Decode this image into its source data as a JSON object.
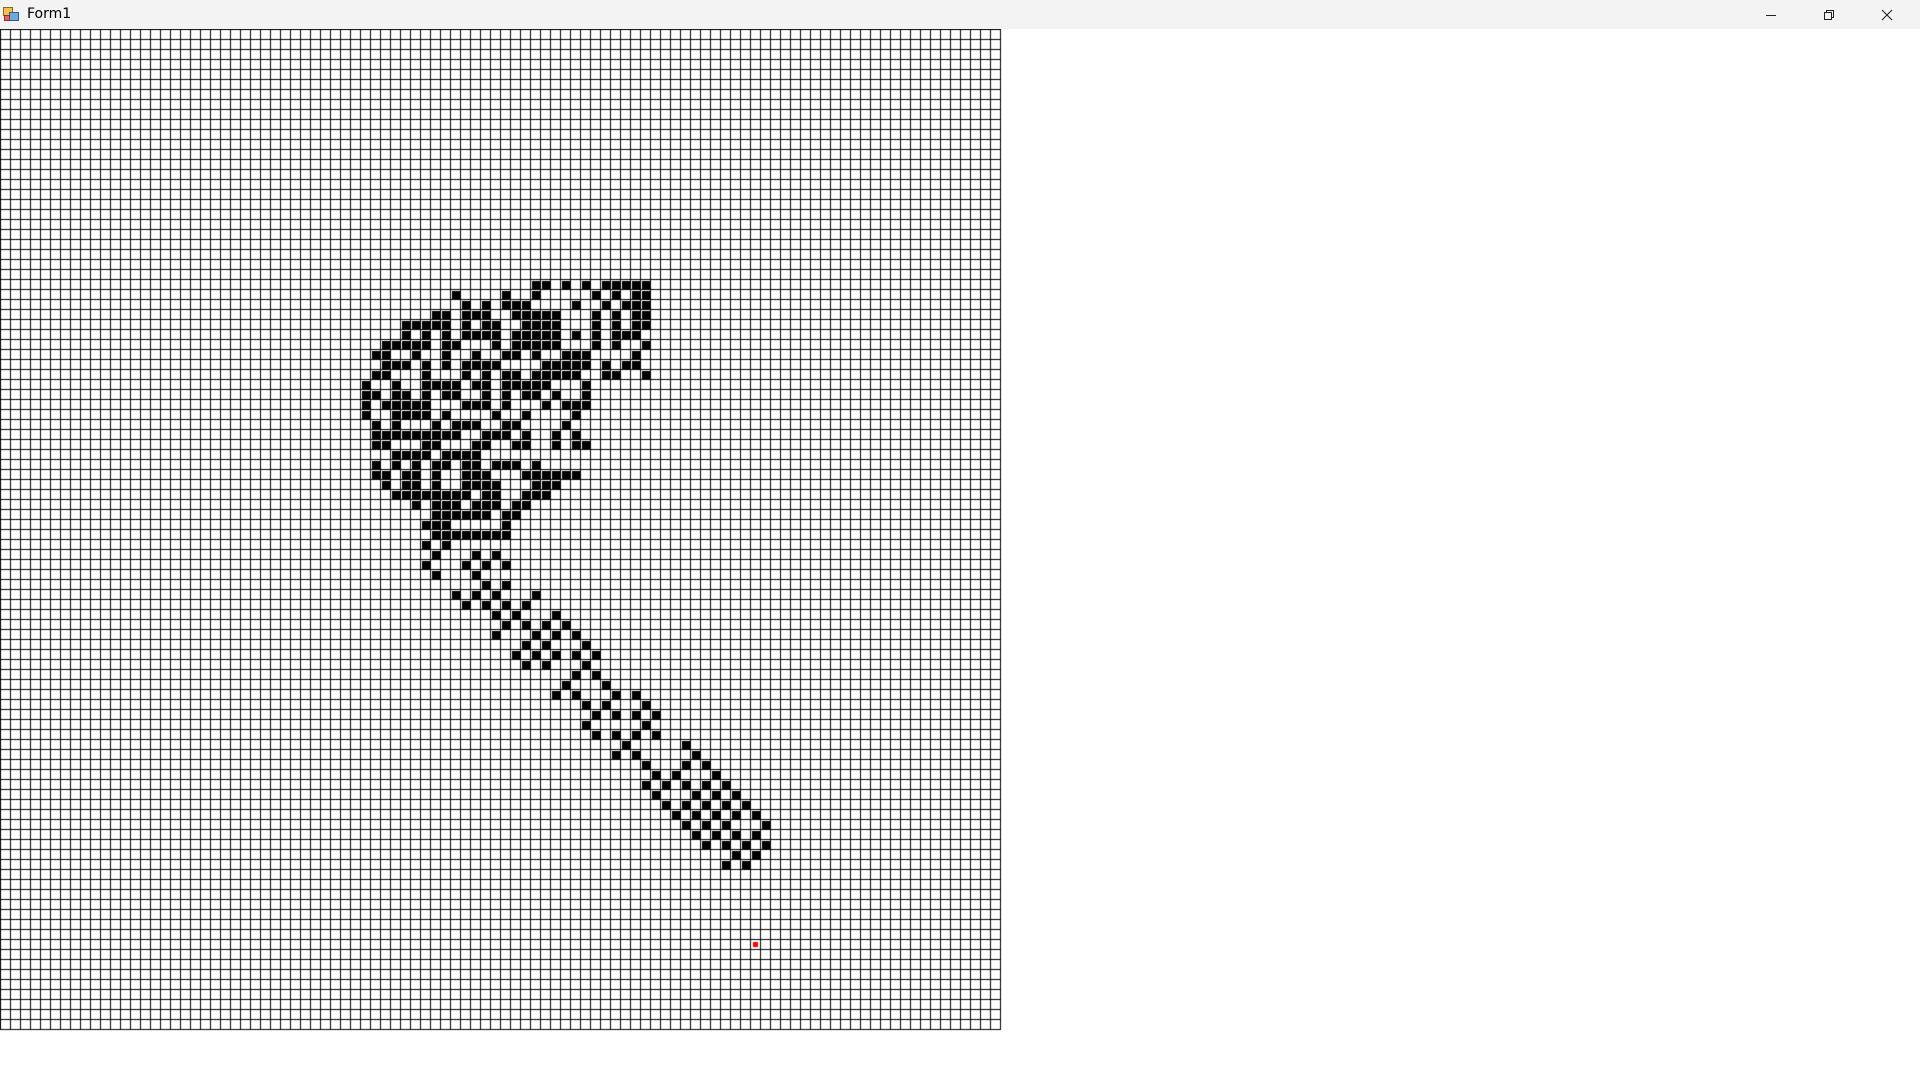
{
  "window": {
    "title": "Form1",
    "app_icon": "winforms-app-icon",
    "buttons": {
      "minimize": "minimize-icon",
      "maximize": "restore-icon",
      "close": "close-icon"
    }
  },
  "grid": {
    "rows": 100,
    "cols": 100,
    "colors": {
      "empty_cell": "#ffffff",
      "filled_cell": "#000000",
      "grid_line": "#000000",
      "agent_cell": "#ff0000"
    }
  }
}
